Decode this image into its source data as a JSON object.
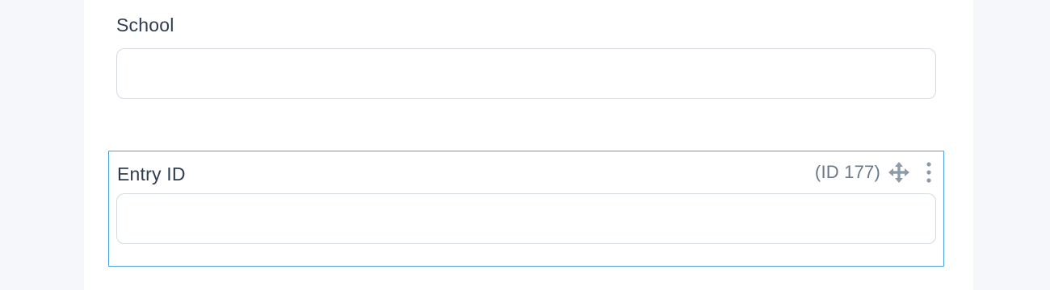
{
  "form": {
    "fields": [
      {
        "label": "School",
        "value": ""
      },
      {
        "label": "Entry ID",
        "id_badge": "(ID 177)",
        "value": "",
        "selected": true
      }
    ]
  },
  "icons": {
    "move": "move-arrows-icon",
    "more": "vertical-ellipsis-icon"
  },
  "colors": {
    "selected_border": "#4a9fe0",
    "input_border": "#d4d9e0",
    "icon": "#8e9aa8",
    "page_background": "#f5f7fb"
  }
}
